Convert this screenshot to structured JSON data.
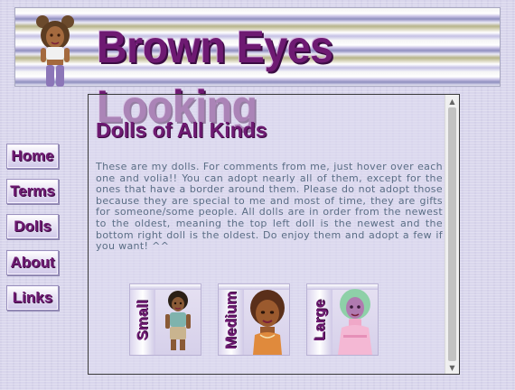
{
  "banner": {
    "title": "Brown Eyes Looking",
    "colors": {
      "title": "#6e1a72",
      "stripe_purple": "#8f8fbf",
      "stripe_olive": "#b7b48b"
    }
  },
  "nav": {
    "items": [
      {
        "label": "Home"
      },
      {
        "label": "Terms"
      },
      {
        "label": "Dolls"
      },
      {
        "label": "About"
      },
      {
        "label": "Links"
      }
    ]
  },
  "content": {
    "heading": "Dolls of All Kinds",
    "intro": "These are my dolls. For comments from me, just hover over each one and volia!! You can adopt nearly all of them, except for the ones that have a border around them. Please do not adopt those because they are special to me and most of time, they are gifts for someone/some people. All dolls are in order from the newest to the oldest, meaning the top left doll is the newest and the bottom right doll is the oldest. Do enjoy them and adopt a few if you want! ^^",
    "categories": [
      {
        "label": "Small"
      },
      {
        "label": "Medium"
      },
      {
        "label": "Large"
      }
    ]
  },
  "scrollbar": {
    "up_icon": "▲",
    "down_icon": "▼",
    "position_fraction": 0.0
  },
  "colors": {
    "accent": "#6e1a72",
    "body_text": "#5a6d85",
    "background": "#d9d6ec"
  }
}
